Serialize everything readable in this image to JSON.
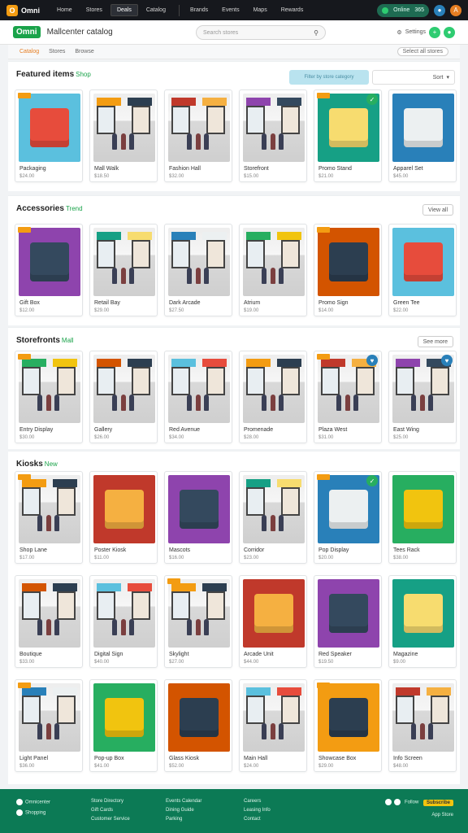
{
  "topbar": {
    "logo_letter": "O",
    "brand": "Omni",
    "nav": [
      "Home",
      "Stores",
      "Deals",
      "Catalog",
      "Brands",
      "Events",
      "Maps",
      "Rewards"
    ],
    "active_index": 2,
    "pill_text": "Online",
    "pill_count": "365",
    "avatar_initial": "A"
  },
  "header": {
    "logo": "Omni",
    "title": "Mallcenter catalog",
    "search_placeholder": "Search stores",
    "right_label": "Settings"
  },
  "crumbs": {
    "items": [
      "Catalog",
      "Stores",
      "Browse"
    ],
    "active_index": 0,
    "right": "Select all stores"
  },
  "sections": [
    {
      "title": "Featured items",
      "tag": "Shop",
      "filter_blue": "Filter by store category",
      "filter_select": "Sort",
      "cards": [
        {
          "name": "Packaging",
          "price": "$24.00"
        },
        {
          "name": "Mall Walk",
          "price": "$18.50"
        },
        {
          "name": "Fashion Hall",
          "price": "$32.00"
        },
        {
          "name": "Storefront",
          "price": "$15.00"
        },
        {
          "name": "Promo Stand",
          "price": "$21.00"
        },
        {
          "name": "Apparel Set",
          "price": "$45.00"
        }
      ]
    },
    {
      "title": "Accessories",
      "tag": "Trend",
      "button": "View all",
      "cards": [
        {
          "name": "Gift Box",
          "price": "$12.00"
        },
        {
          "name": "Retail Bay",
          "price": "$29.00"
        },
        {
          "name": "Dark Arcade",
          "price": "$27.50"
        },
        {
          "name": "Atrium",
          "price": "$19.00"
        },
        {
          "name": "Promo Sign",
          "price": "$14.00"
        },
        {
          "name": "Green Tee",
          "price": "$22.00"
        }
      ]
    },
    {
      "title": "Storefronts",
      "tag": "Mall",
      "button": "See more",
      "cards": [
        {
          "name": "Entry Display",
          "price": "$30.00"
        },
        {
          "name": "Gallery",
          "price": "$26.00"
        },
        {
          "name": "Red Avenue",
          "price": "$34.00"
        },
        {
          "name": "Promenade",
          "price": "$28.00"
        },
        {
          "name": "Plaza West",
          "price": "$31.00"
        },
        {
          "name": "East Wing",
          "price": "$25.00"
        }
      ]
    },
    {
      "title": "Kiosks",
      "tag": "New",
      "cards": [
        {
          "name": "Shop Lane",
          "price": "$17.00"
        },
        {
          "name": "Poster Kiosk",
          "price": "$11.00"
        },
        {
          "name": "Mascots",
          "price": "$16.00"
        },
        {
          "name": "Corridor",
          "price": "$23.00"
        },
        {
          "name": "Pop Display",
          "price": "$20.00"
        },
        {
          "name": "Tees Rack",
          "price": "$38.00"
        },
        {
          "name": "Boutique",
          "price": "$33.00"
        },
        {
          "name": "Digital Sign",
          "price": "$40.00"
        },
        {
          "name": "Skylight",
          "price": "$27.00"
        },
        {
          "name": "Arcade Unit",
          "price": "$44.00"
        },
        {
          "name": "Red Speaker",
          "price": "$19.50"
        },
        {
          "name": "Magazine",
          "price": "$9.00"
        },
        {
          "name": "Light Panel",
          "price": "$36.00"
        },
        {
          "name": "Pop-up Box",
          "price": "$41.00"
        },
        {
          "name": "Glass Kiosk",
          "price": "$52.00"
        },
        {
          "name": "Main Hall",
          "price": "$24.00"
        },
        {
          "name": "Showcase Box",
          "price": "$29.00"
        },
        {
          "name": "Info Screen",
          "price": "$48.00"
        }
      ]
    }
  ],
  "footer": {
    "brand": "Omnicenter",
    "sub": "Shopping",
    "col1": [
      "Store Directory",
      "Gift Cards",
      "Customer Service"
    ],
    "col2": [
      "Events Calendar",
      "Dining Guide",
      "Parking"
    ],
    "col3": [
      "Careers",
      "Leasing Info",
      "Contact"
    ],
    "right_label": "Follow",
    "right_badge": "Subscribe",
    "right_sub": "App Store"
  },
  "colors": {
    "accent_green": "#1aa34a",
    "footer_green": "#0c7a55",
    "topbar": "#16181d"
  }
}
